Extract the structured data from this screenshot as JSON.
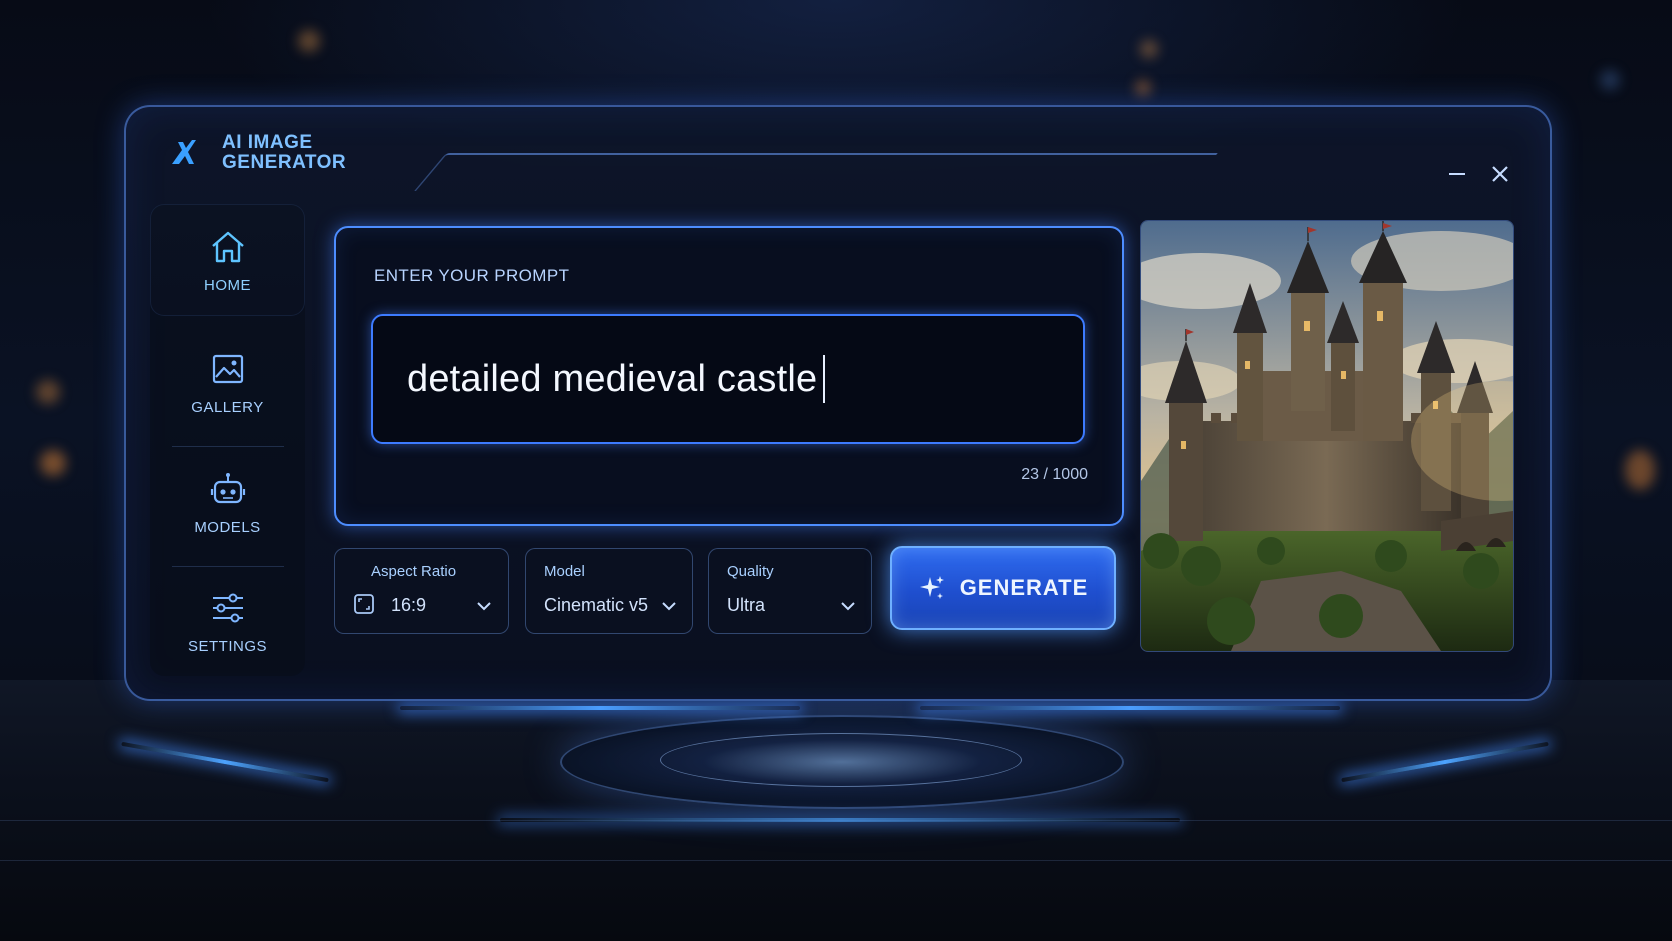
{
  "app": {
    "title_line1": "AI IMAGE",
    "title_line2": "GENERATOR"
  },
  "window_controls": {
    "minimize_icon": "minimize-icon",
    "close_icon": "close-icon"
  },
  "sidebar": {
    "items": [
      {
        "label": "HOME",
        "icon": "home-icon",
        "active": true
      },
      {
        "label": "GALLERY",
        "icon": "image-icon",
        "active": false
      },
      {
        "label": "MODELS",
        "icon": "robot-icon",
        "active": false
      },
      {
        "label": "SETTINGS",
        "icon": "sliders-icon",
        "active": false
      }
    ]
  },
  "prompt": {
    "heading": "ENTER YOUR PROMPT",
    "value": "detailed medieval castle",
    "char_count": "23 / 1000"
  },
  "options": {
    "aspect_ratio": {
      "label": "Aspect Ratio",
      "value": "16:9"
    },
    "model": {
      "label": "Model",
      "value": "Cinematic v5"
    },
    "quality": {
      "label": "Quality",
      "value": "Ultra"
    }
  },
  "generate": {
    "label": "GENERATE",
    "icon": "sparkle-icon"
  },
  "preview": {
    "subject": "castle-image"
  },
  "colors": {
    "accent": "#4d8dff",
    "accent_light": "#7fc0ff",
    "button": "#2f6cf0",
    "background": "#0a1224"
  }
}
